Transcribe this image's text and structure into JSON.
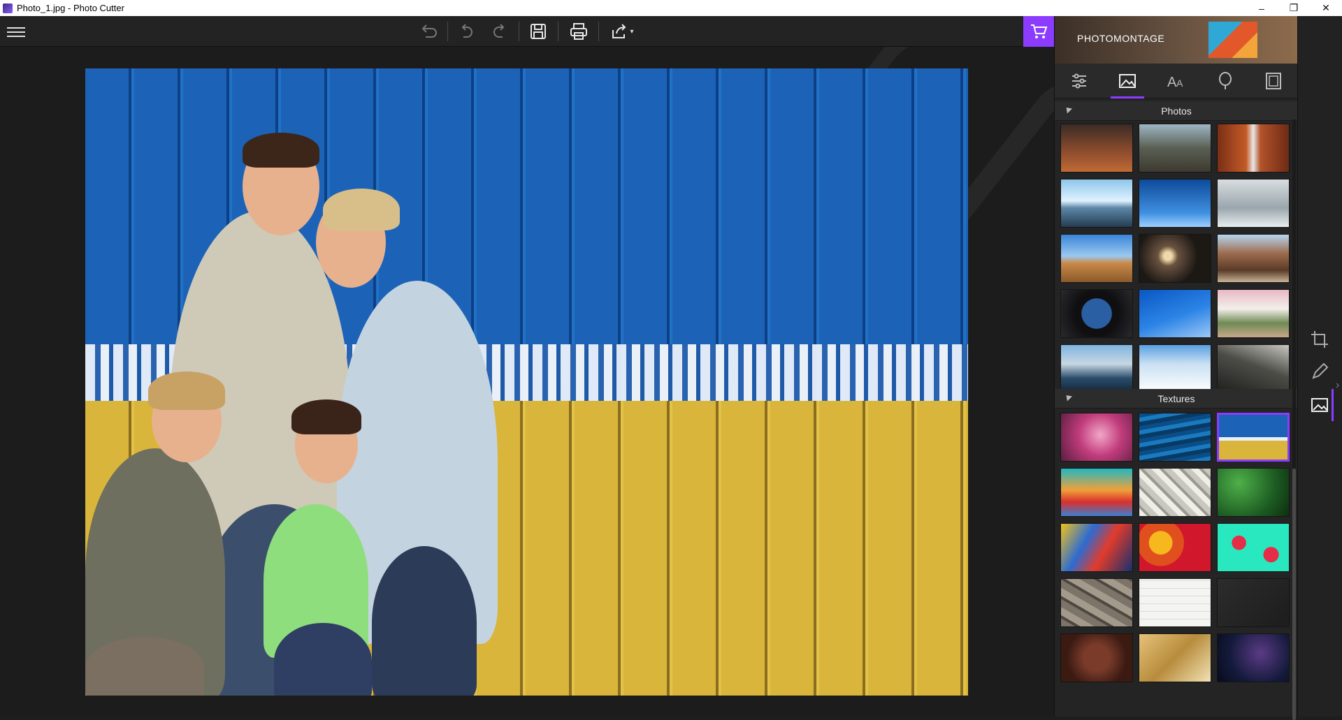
{
  "window": {
    "title": "Photo_1.jpg - Photo Cutter",
    "controls": [
      "–",
      "❐",
      "✕"
    ]
  },
  "toolbar": {
    "icons": [
      "menu-icon",
      "undo-icon",
      "undo-step-icon",
      "redo-icon",
      "save-icon",
      "print-icon",
      "share-icon"
    ],
    "share_dropdown": "▾"
  },
  "cart": {
    "icon": "cart-icon",
    "color": "#8b3cff"
  },
  "side_panel": {
    "banner": {
      "label": "PHOTOMONTAGE"
    },
    "tabs": [
      {
        "name": "adjustments",
        "icon": "sliders-icon"
      },
      {
        "name": "backgrounds",
        "icon": "image-icon",
        "active": true
      },
      {
        "name": "text",
        "icon": "text-icon"
      },
      {
        "name": "stickers",
        "icon": "balloon-icon"
      },
      {
        "name": "frames",
        "icon": "frame-icon"
      }
    ],
    "sections": [
      {
        "title": "Photos",
        "thumbs": [
          "desert-sunset",
          "mountain-valley",
          "canyon-waterfall",
          "glacier-lake",
          "blue-sky",
          "lighthouse-sea",
          "dry-tree-desert",
          "dark-spotlight",
          "western-saloon",
          "space-station-window",
          "blue-sky-trail",
          "wedding-aisle",
          "venice-gondolas",
          "snowy-slope",
          "stormy-road"
        ]
      },
      {
        "title": "Textures",
        "thumbs": [
          "pink-smoke",
          "blue-water",
          "blue-yellow-fence",
          "paint-stroke",
          "newspaper-collage",
          "green-leaves",
          "abstract-paint",
          "flowers",
          "strawberries-mint",
          "stone-wall",
          "white-brick",
          "dark-leather",
          "brown-leather",
          "golden-abstract",
          "starry-sky"
        ]
      }
    ],
    "selected_texture": "blue-yellow-fence"
  },
  "right_rail": {
    "icons": [
      "crop-icon",
      "brush-icon",
      "background-icon"
    ],
    "expand": "›"
  },
  "colors": {
    "accent": "#8b3cff",
    "panel": "#242424",
    "canvas": "#1c1c1c"
  }
}
